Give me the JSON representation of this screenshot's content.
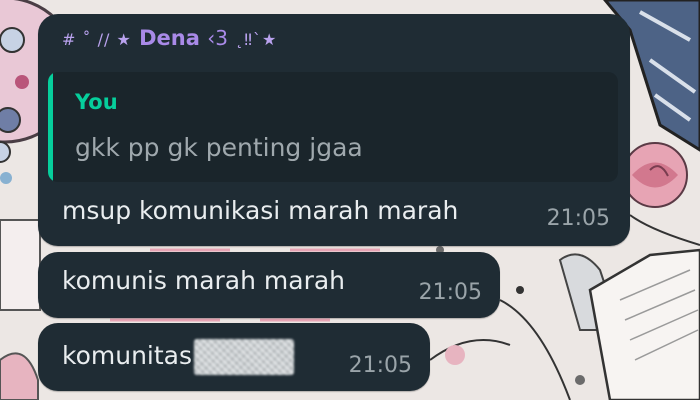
{
  "chat": {
    "sender": {
      "deco_left": "# ˚ // ★",
      "name": "Dena",
      "suffix": "‹3",
      "deco_right": "˛‼`★"
    },
    "reply": {
      "author": "You",
      "text": "gkk pp gk penting jgaa"
    },
    "messages": [
      {
        "text": "msup komunikasi marah marah",
        "time": "21:05"
      },
      {
        "text": "komunis marah marah",
        "time": "21:05"
      },
      {
        "text": "komunitas",
        "time": "21:05",
        "censored_suffix": true
      }
    ]
  },
  "colors": {
    "bubble": "#1f2c34",
    "quote_bg": "#1a252b",
    "sender_name": "#a98ae8",
    "quote_accent": "#06cf9c",
    "message_text": "#e9edef",
    "timestamp": "#9aa4a9",
    "wallpaper": "#ece7e4"
  },
  "icons": {
    "sender_decoration": "sparkle-star-icon"
  }
}
